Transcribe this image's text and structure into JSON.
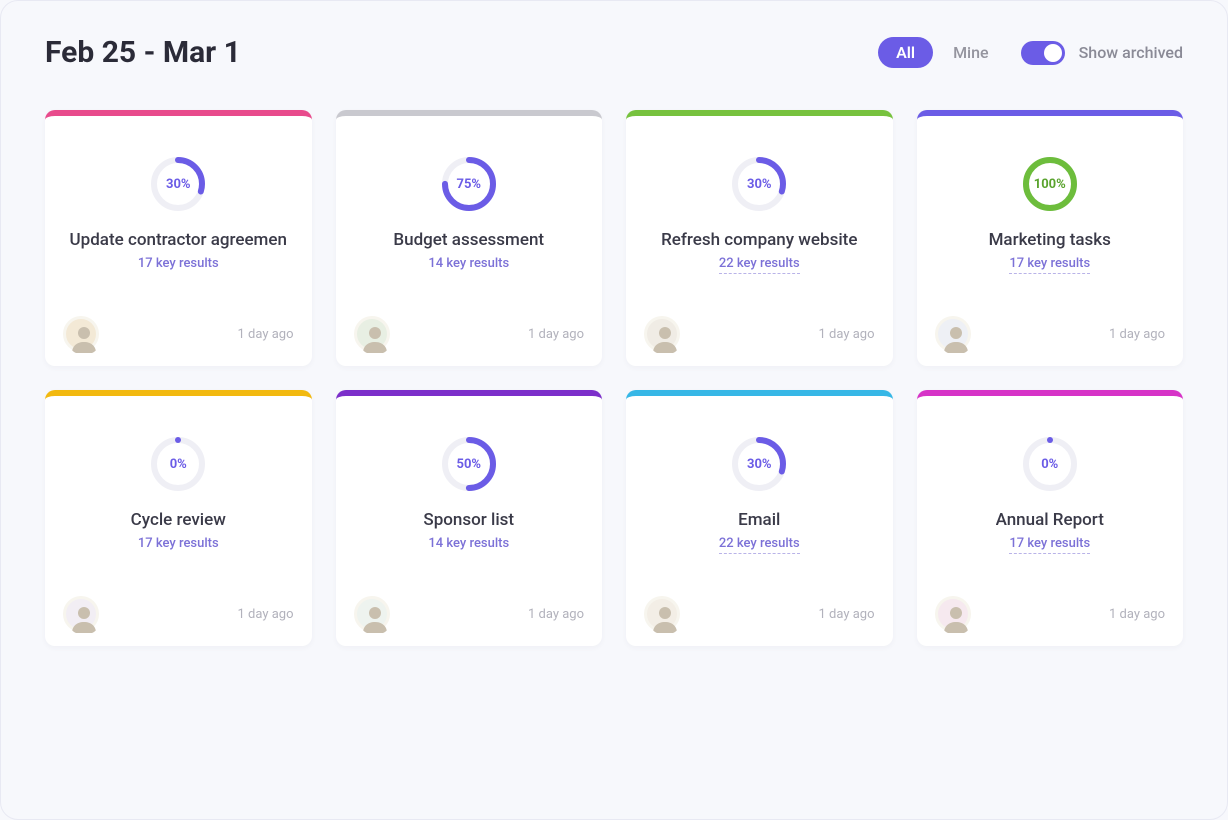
{
  "header": {
    "date_range": "Feb 25 - Mar 1",
    "filter_all": "All",
    "filter_mine": "Mine",
    "toggle_label": "Show archived"
  },
  "colors": {
    "purple": "#6b5ce6",
    "green": "#6dbd3c"
  },
  "cards": [
    {
      "accent": "#e84b8c",
      "percent": 30,
      "ring_color": "purple",
      "title": "Update contractor agreemen",
      "key_results": "17 key results",
      "kr_underlined": false,
      "timestamp": "1 day ago",
      "avatar_bg": "#f3e9d6"
    },
    {
      "accent": "#c9c9cf",
      "percent": 75,
      "ring_color": "purple",
      "title": "Budget assessment",
      "key_results": "14 key results",
      "kr_underlined": false,
      "timestamp": "1 day ago",
      "avatar_bg": "#e8efe3"
    },
    {
      "accent": "#77c23e",
      "percent": 30,
      "ring_color": "purple",
      "title": "Refresh company website",
      "key_results": "22 key results",
      "kr_underlined": true,
      "timestamp": "1 day ago",
      "avatar_bg": "#f0ece5"
    },
    {
      "accent": "#6b5ce6",
      "percent": 100,
      "ring_color": "green",
      "title": "Marketing tasks",
      "key_results": "17 key results",
      "kr_underlined": true,
      "timestamp": "1 day ago",
      "avatar_bg": "#eef0f5"
    },
    {
      "accent": "#f2b90f",
      "percent": 0,
      "ring_color": "purple",
      "title": "Cycle review",
      "key_results": "17 key results",
      "kr_underlined": false,
      "timestamp": "1 day ago",
      "avatar_bg": "#f2eef4"
    },
    {
      "accent": "#7c2fca",
      "percent": 50,
      "ring_color": "purple",
      "title": "Sponsor list",
      "key_results": "14 key results",
      "kr_underlined": false,
      "timestamp": "1 day ago",
      "avatar_bg": "#eef3ef"
    },
    {
      "accent": "#37b7e6",
      "percent": 30,
      "ring_color": "purple",
      "title": "Email",
      "key_results": "22 key results",
      "kr_underlined": true,
      "timestamp": "1 day ago",
      "avatar_bg": "#f3eee6"
    },
    {
      "accent": "#d633c7",
      "percent": 0,
      "ring_color": "purple",
      "title": "Annual Report",
      "key_results": "17 key results",
      "kr_underlined": true,
      "timestamp": "1 day ago",
      "avatar_bg": "#f6e9ef"
    }
  ]
}
